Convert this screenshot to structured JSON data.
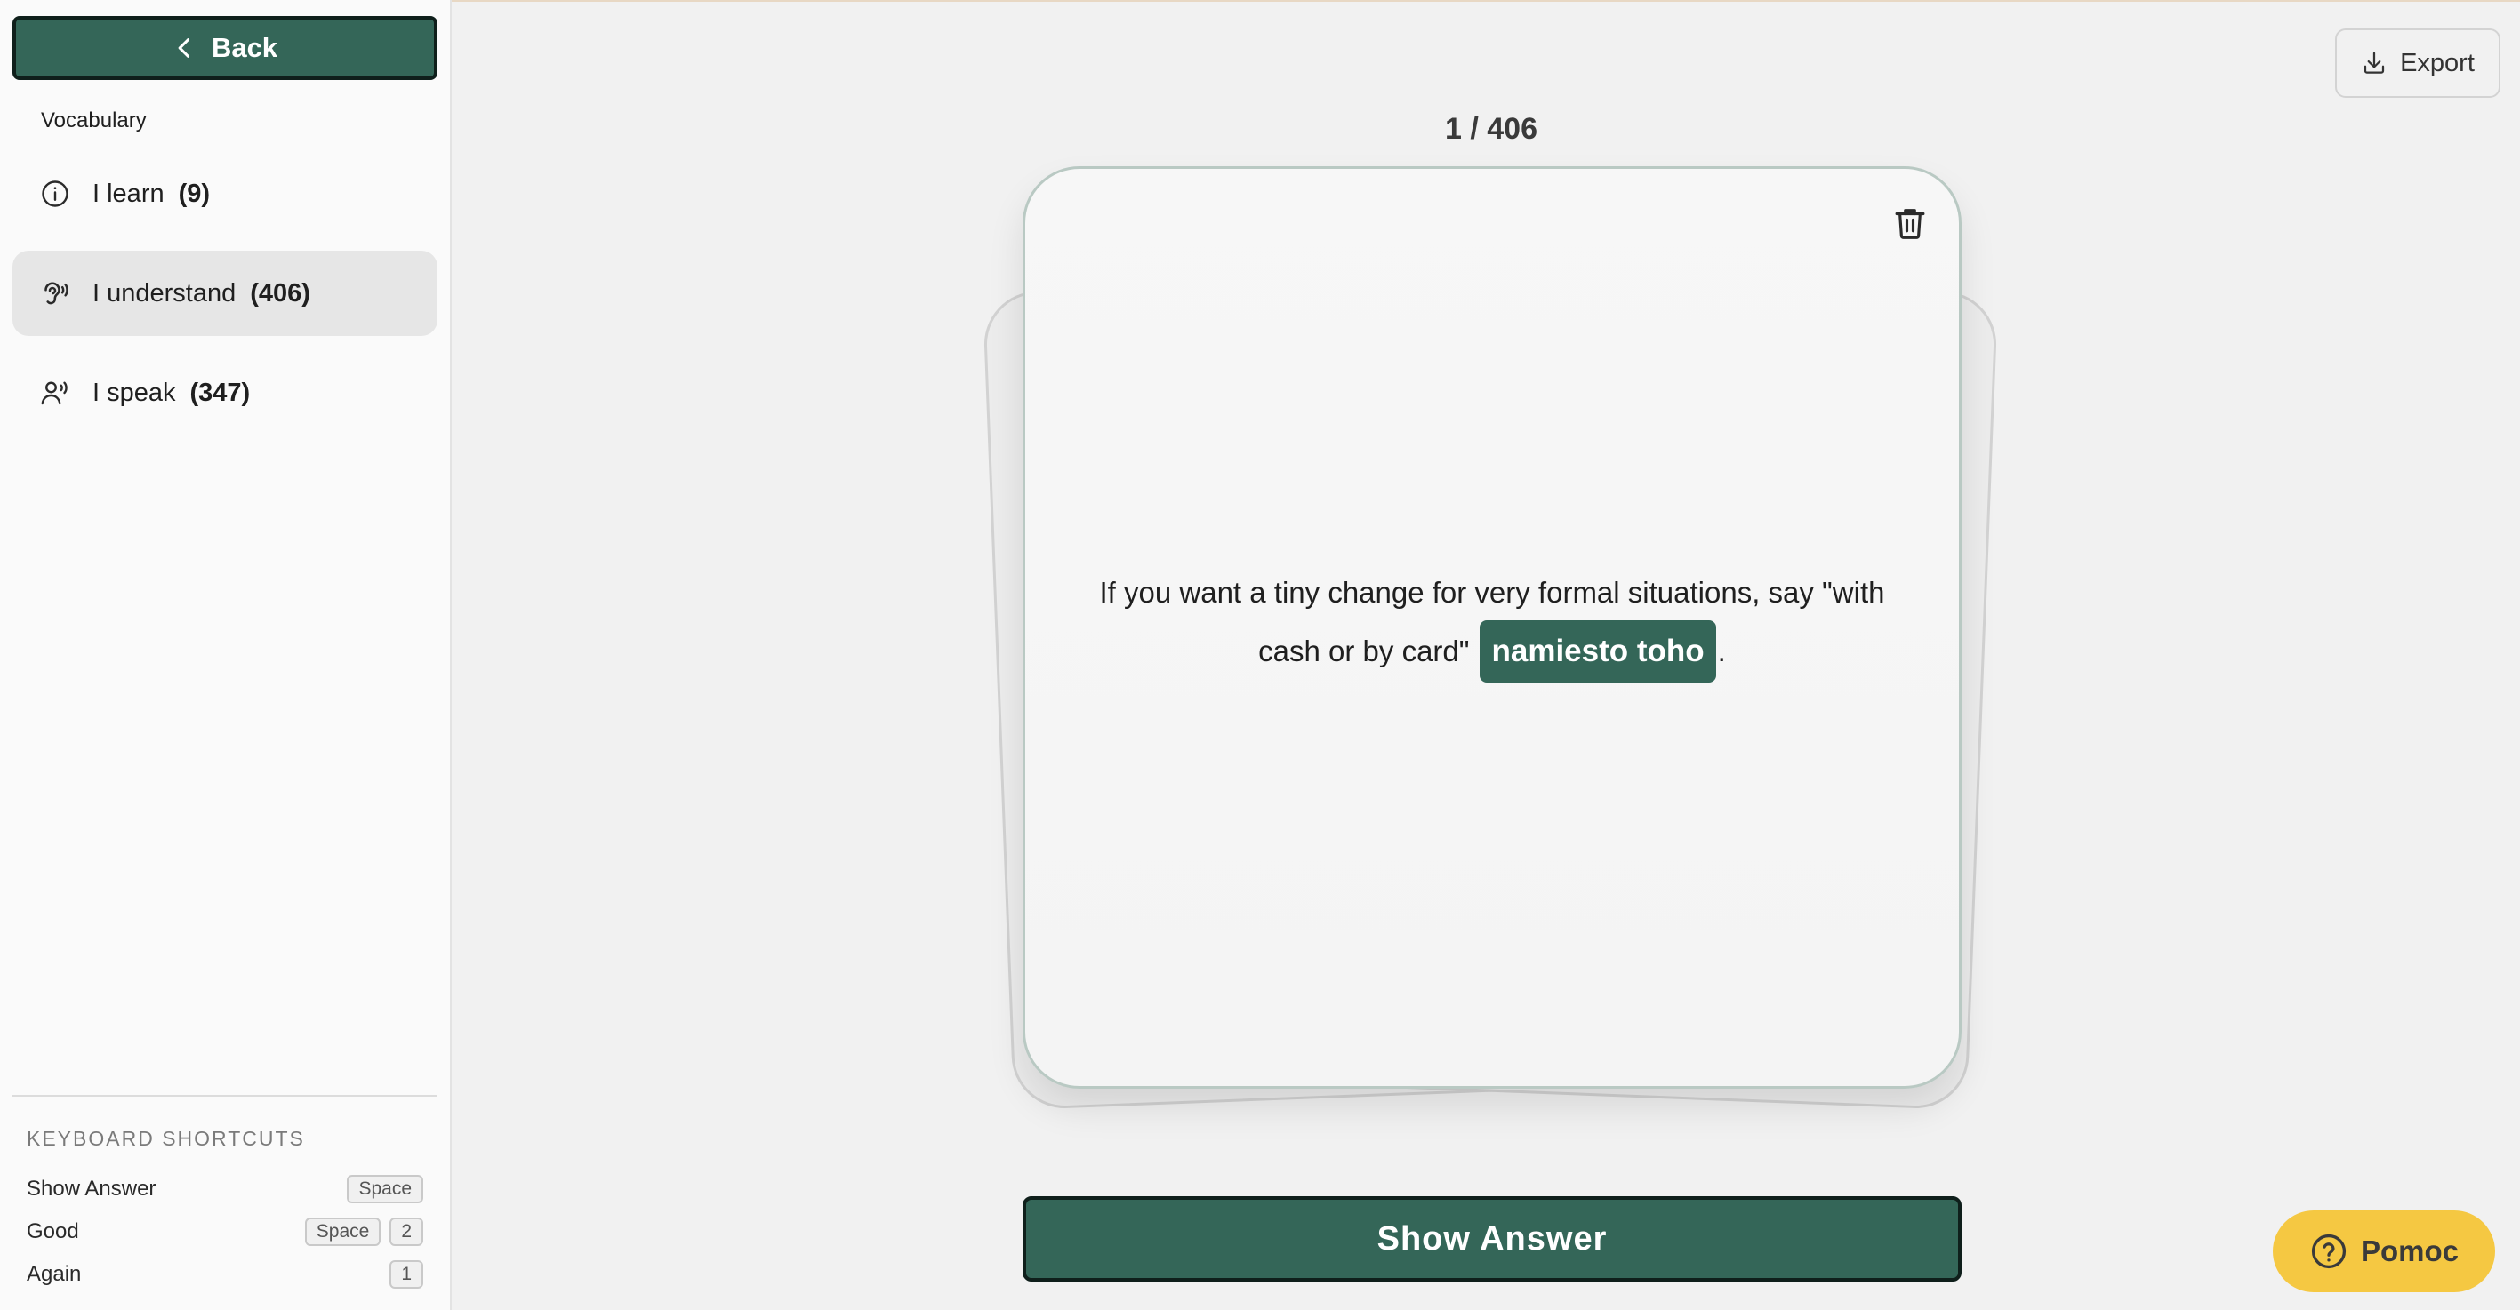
{
  "sidebar": {
    "back_label": "Back",
    "section_label": "Vocabulary",
    "items": [
      {
        "label": "I learn",
        "count": "(9)",
        "icon": "info-icon",
        "active": false
      },
      {
        "label": "I understand",
        "count": "(406)",
        "icon": "ear-icon",
        "active": true
      },
      {
        "label": "I speak",
        "count": "(347)",
        "icon": "speaking-person-icon",
        "active": false
      }
    ],
    "shortcuts": {
      "title": "KEYBOARD SHORTCUTS",
      "rows": [
        {
          "label": "Show Answer",
          "keys": [
            "Space"
          ]
        },
        {
          "label": "Good",
          "keys": [
            "Space",
            "2"
          ]
        },
        {
          "label": "Again",
          "keys": [
            "1"
          ]
        }
      ]
    }
  },
  "main": {
    "export_label": "Export",
    "counter": "1 / 406",
    "card": {
      "text_before": "If you want a tiny change for very formal situations, say \"with cash or by card\"",
      "highlight": "namiesto toho",
      "text_after": "."
    },
    "show_answer_label": "Show Answer",
    "help_label": "Pomoc"
  },
  "colors": {
    "accent": "#346658",
    "help": "#f5c842",
    "background": "#f1f1f1"
  }
}
